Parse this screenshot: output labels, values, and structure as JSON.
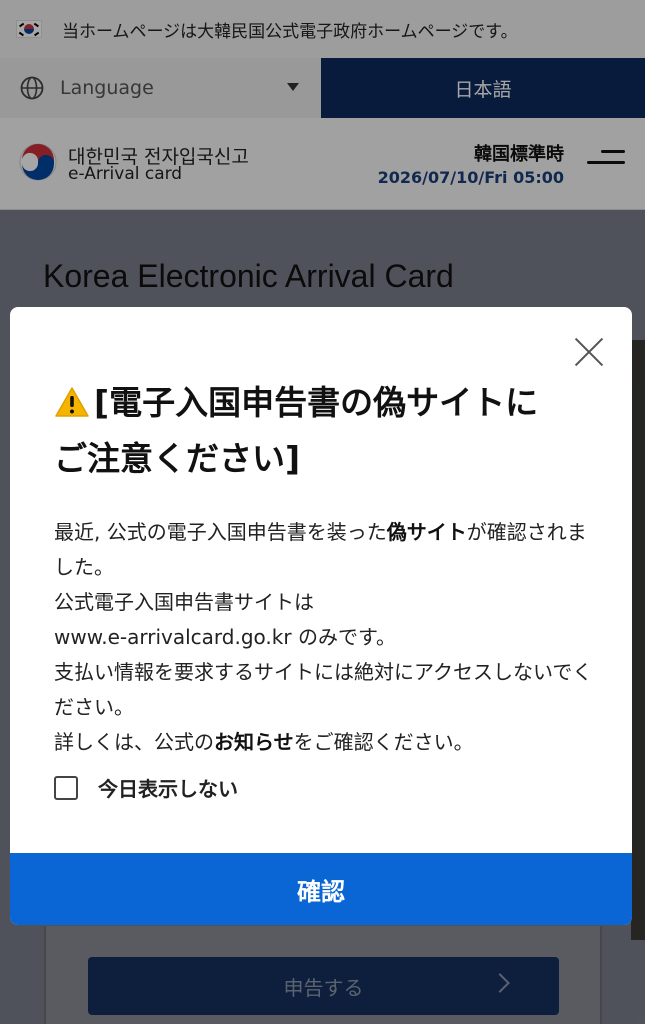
{
  "gov_notice": {
    "text": "当ホームページは大韓民国公式電子政府ホームページです。",
    "flag_icon": "korea-flag-icon"
  },
  "language_bar": {
    "select_label": "Language",
    "globe_icon": "globe-icon",
    "current_language": "日本語"
  },
  "header": {
    "logo_ko": "대한민국 전자입국신고",
    "logo_en": "e-Arrival card",
    "timezone_label": "韓国標準時",
    "datetime": "2026/07/10/Fri 05:00",
    "menu_icon": "hamburger-menu-icon"
  },
  "page": {
    "title": "Korea Electronic Arrival Card",
    "declare_button": "申告する"
  },
  "modal": {
    "title_line1": "[電子入国申告書の偽サイトに",
    "title_line2": "ご注意ください]",
    "body": {
      "p1_a": "最近, 公式の電子入国申告書を装った",
      "p1_bold": "偽サイト",
      "p1_b": "が確認されました。",
      "p2": "公式電子入国申告書サイトは",
      "p3": "www.e-arrivalcard.go.kr のみです。",
      "p4": "支払い情報を要求するサイトには絶対にアクセスしないでください。",
      "p5_a": "詳しくは、公式の",
      "p5_bold": "お知らせ",
      "p5_b": "をご確認ください。"
    },
    "checkbox_label": "今日表示しない",
    "confirm_button": "確認",
    "colors": {
      "confirm": "#0a66d4",
      "warning": "#f5b400"
    }
  }
}
